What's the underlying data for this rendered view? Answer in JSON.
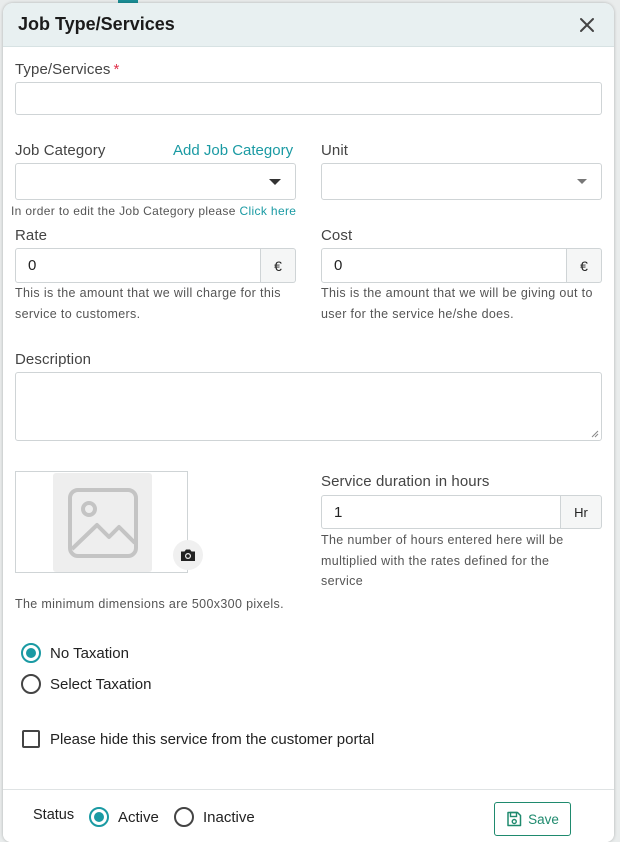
{
  "modal": {
    "title": "Job Type/Services"
  },
  "fields": {
    "type_services": {
      "label": "Type/Services",
      "required": "*",
      "value": ""
    },
    "job_category": {
      "label": "Job Category",
      "add_link": "Add Job Category",
      "value": "",
      "help_prefix": "In order to edit the Job Category please",
      "help_link": "Click here"
    },
    "unit": {
      "label": "Unit",
      "value": ""
    },
    "rate": {
      "label": "Rate",
      "value": "0",
      "currency": "€",
      "help": "This is the amount that we will charge for this service to customers."
    },
    "cost": {
      "label": "Cost",
      "value": "0",
      "currency": "€",
      "help": "This is the amount that we will be giving out to user for the service he/she does."
    },
    "description": {
      "label": "Description",
      "value": ""
    },
    "image": {
      "help": "The minimum dimensions are 500x300 pixels."
    },
    "duration": {
      "label": "Service duration in hours",
      "value": "1",
      "unit": "Hr",
      "help": "The number of hours entered here will be multiplied with the rates defined for the service"
    }
  },
  "taxation": {
    "options": [
      {
        "label": "No Taxation",
        "selected": true
      },
      {
        "label": "Select Taxation",
        "selected": false
      }
    ]
  },
  "hide_portal": {
    "label": "Please hide this service from the customer portal",
    "checked": false
  },
  "footer": {
    "status_label": "Status",
    "status_options": [
      {
        "label": "Active",
        "selected": true
      },
      {
        "label": "Inactive",
        "selected": false
      }
    ],
    "save_label": "Save"
  },
  "colors": {
    "accent": "#1a9aa3",
    "save_green": "#1f8a6e",
    "required": "#e0314b",
    "header_bg": "#e8f0f1"
  }
}
